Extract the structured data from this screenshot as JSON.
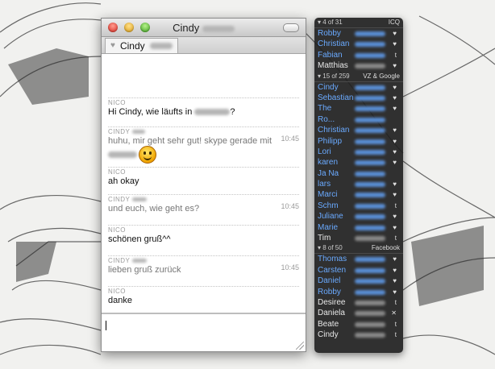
{
  "chat_window": {
    "title": "Cindy",
    "tab_label": "Cindy",
    "messages": [
      {
        "sender": "NICO",
        "text": "Hi Cindy, wie läufts in",
        "suffix": "?",
        "time": "",
        "muted": false
      },
      {
        "sender": "CINDY",
        "text": "huhu, mir geht sehr gut! skype gerade mit",
        "suffix": "",
        "time": "10:45",
        "muted": true,
        "smiley": true
      },
      {
        "sender": "NICO",
        "text": "ah okay",
        "suffix": "",
        "time": "",
        "muted": false
      },
      {
        "sender": "CINDY",
        "text": "und euch, wie geht es?",
        "suffix": "",
        "time": "10:45",
        "muted": true
      },
      {
        "sender": "NICO",
        "text": "schönen gruß^^",
        "suffix": "",
        "time": "",
        "muted": false
      },
      {
        "sender": "CINDY",
        "text": "lieben gruß zurück",
        "suffix": "",
        "time": "10:45",
        "muted": true
      },
      {
        "sender": "NICO",
        "text": "danke",
        "suffix": "",
        "time": "",
        "muted": false
      }
    ]
  },
  "contact_list": {
    "groups": [
      {
        "header": "▾ 4 of 31",
        "network": "ICQ",
        "contacts": [
          {
            "name": "Robby",
            "online": true,
            "icon": "♥"
          },
          {
            "name": "Christian",
            "online": true,
            "icon": "♥"
          },
          {
            "name": "Fabian",
            "online": true,
            "icon": "t"
          },
          {
            "name": "Matthias",
            "online": false,
            "icon": "♥"
          }
        ]
      },
      {
        "header": "▾ 15 of 259",
        "network": "VZ & Google",
        "contacts": [
          {
            "name": "Cindy",
            "online": true,
            "icon": "♥"
          },
          {
            "name": "Sebastian",
            "online": true,
            "icon": "♥"
          },
          {
            "name": "The",
            "online": true,
            "icon": "♥"
          },
          {
            "name": "Ro...",
            "online": true,
            "icon": ""
          },
          {
            "name": "Christian",
            "online": true,
            "icon": "♥"
          },
          {
            "name": "Philipp",
            "online": true,
            "icon": "♥"
          },
          {
            "name": "Lori",
            "online": true,
            "icon": "♥"
          },
          {
            "name": "karen",
            "online": true,
            "icon": "♥"
          },
          {
            "name": "Ja Na",
            "online": true,
            "icon": ""
          },
          {
            "name": "lars",
            "online": true,
            "icon": "♥"
          },
          {
            "name": "Marci",
            "online": true,
            "icon": "♥"
          },
          {
            "name": "Schm",
            "online": true,
            "icon": "t"
          },
          {
            "name": "Juliane",
            "online": true,
            "icon": "♥"
          },
          {
            "name": "Marie",
            "online": true,
            "icon": "♥"
          },
          {
            "name": "Tim",
            "online": false,
            "icon": "t"
          }
        ]
      },
      {
        "header": "▾ 8 of 50",
        "network": "Facebook",
        "contacts": [
          {
            "name": "Thomas",
            "online": true,
            "icon": "♥"
          },
          {
            "name": "Carsten",
            "online": true,
            "icon": "♥"
          },
          {
            "name": "Daniel",
            "online": true,
            "icon": "♥"
          },
          {
            "name": "Robby",
            "online": true,
            "icon": "♥"
          },
          {
            "name": "Desiree",
            "online": false,
            "icon": "t"
          },
          {
            "name": "Daniela",
            "online": false,
            "icon": "✕"
          },
          {
            "name": "Beate",
            "online": false,
            "icon": "t"
          },
          {
            "name": "Cindy",
            "online": false,
            "icon": "t"
          }
        ]
      }
    ]
  }
}
